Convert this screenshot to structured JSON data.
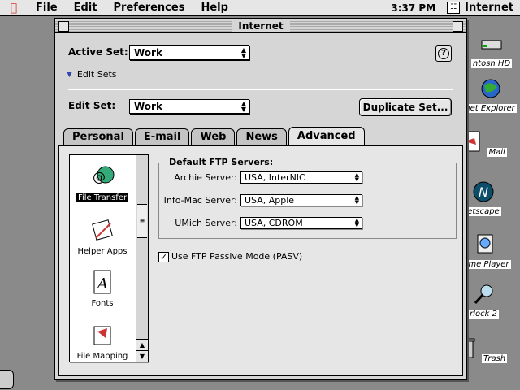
{
  "menubar": {
    "apple_icon": "apple-icon",
    "menus": [
      "File",
      "Edit",
      "Preferences",
      "Help"
    ],
    "clock": "3:37 PM",
    "app_name": "Internet"
  },
  "desktop": {
    "icons": [
      {
        "label": "ntosh HD",
        "icon": "hard-disk-icon"
      },
      {
        "label": "net Explorer",
        "icon": "internet-explorer-icon"
      },
      {
        "label": "Mail",
        "icon": "mail-icon"
      },
      {
        "label": "etscape",
        "icon": "netscape-icon"
      },
      {
        "label": "Time Player",
        "icon": "quicktime-icon"
      },
      {
        "label": "rlock 2",
        "icon": "sherlock-icon"
      },
      {
        "label": "Trash",
        "icon": "trash-icon"
      }
    ]
  },
  "window": {
    "title": "Internet",
    "active_set_label": "Active Set:",
    "active_set_value": "Work",
    "help_icon": "help-icon",
    "edit_sets_label": "Edit Sets",
    "edit_set_label": "Edit Set:",
    "edit_set_value": "Work",
    "duplicate_button": "Duplicate Set...",
    "tabs": [
      "Personal",
      "E-mail",
      "Web",
      "News",
      "Advanced"
    ],
    "active_tab": "Advanced",
    "list_items": [
      {
        "label": "File Transfer",
        "icon": "file-transfer-icon",
        "selected": true
      },
      {
        "label": "Helper Apps",
        "icon": "helper-apps-icon",
        "selected": false
      },
      {
        "label": "Fonts",
        "icon": "fonts-icon",
        "selected": false
      },
      {
        "label": "File Mapping",
        "icon": "file-mapping-icon",
        "selected": false
      }
    ],
    "ftp_group": {
      "title": "Default FTP Servers:",
      "archie_label": "Archie Server:",
      "archie_value": "USA, InterNIC",
      "infomac_label": "Info-Mac Server:",
      "infomac_value": "USA, Apple",
      "umich_label": "UMich Server:",
      "umich_value": "USA, CDROM"
    },
    "passive_mode_label": "Use FTP Passive Mode (PASV)",
    "passive_mode_checked": true
  }
}
